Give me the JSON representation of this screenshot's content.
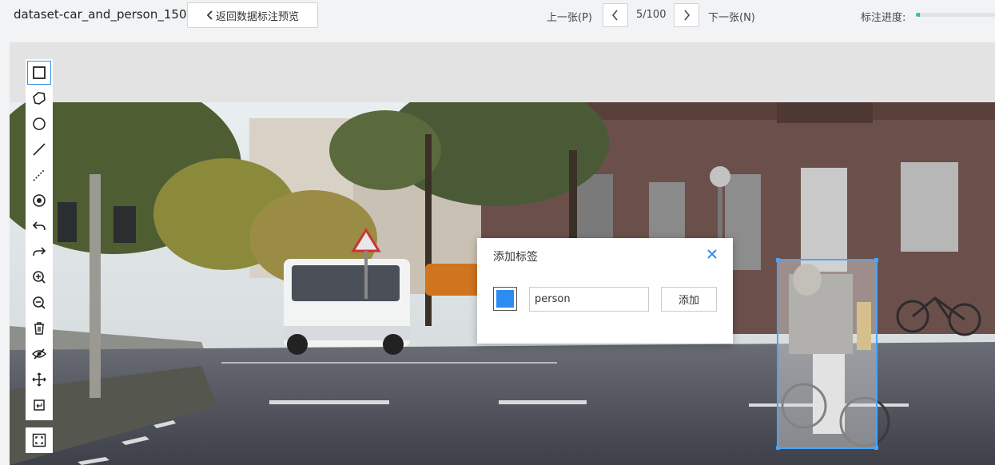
{
  "header": {
    "dataset_name": "dataset-car_and_person_150",
    "back_label": "返回数据标注预览",
    "prev_label": "上一张(P)",
    "page_indicator": "5/100",
    "next_label": "下一张(N)",
    "progress_label": "标注进度:",
    "progress_fraction": 0.05,
    "progress_color": "#3cc08f"
  },
  "toolbar": {
    "tools": [
      {
        "name": "rectangle-icon",
        "active": true
      },
      {
        "name": "polygon-icon"
      },
      {
        "name": "circle-icon"
      },
      {
        "name": "line-icon"
      },
      {
        "name": "dashed-line-icon"
      },
      {
        "name": "point-icon"
      },
      {
        "name": "undo-icon"
      },
      {
        "name": "redo-icon"
      },
      {
        "name": "zoom-in-icon"
      },
      {
        "name": "zoom-out-icon"
      },
      {
        "name": "delete-icon"
      },
      {
        "name": "hide-icon"
      },
      {
        "name": "move-icon"
      },
      {
        "name": "reset-icon"
      }
    ],
    "fit_icon": "fit-screen-icon"
  },
  "annotation": {
    "box_color": "#4aa3ff"
  },
  "dialog": {
    "title": "添加标签",
    "swatch_color": "#2d8cf0",
    "input_value": "person",
    "add_label": "添加",
    "accent": "#2d8cf0"
  }
}
